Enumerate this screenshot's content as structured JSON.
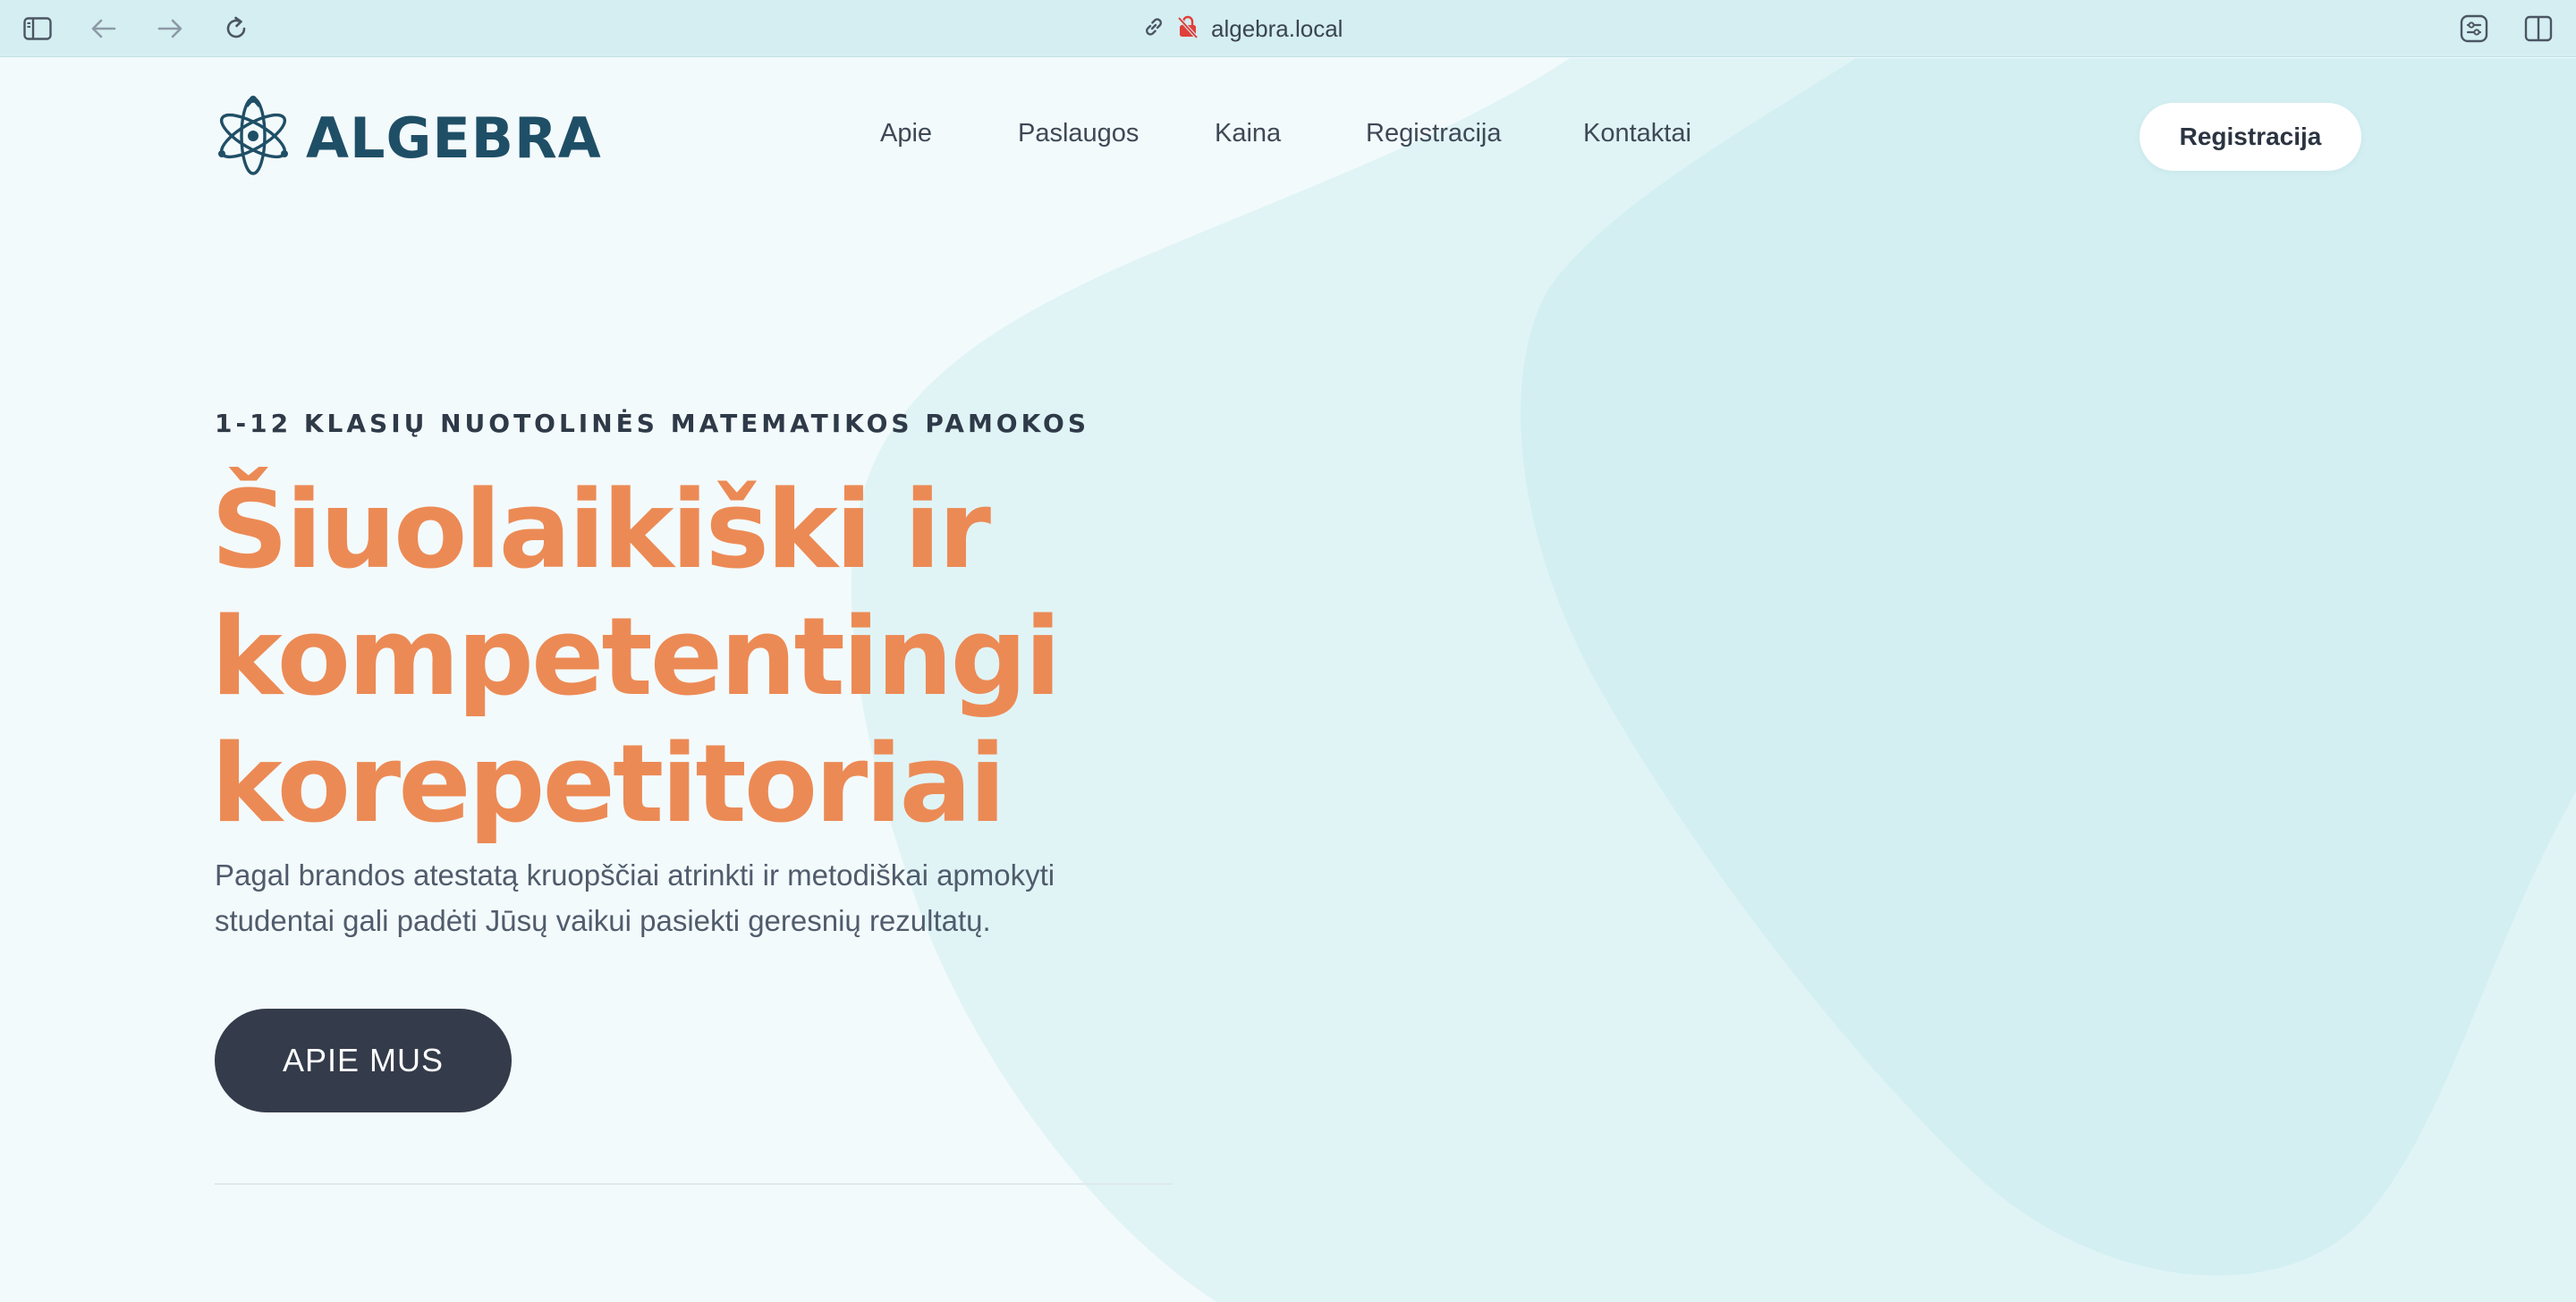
{
  "browser": {
    "url": "algebra.local",
    "icons": [
      "sidebar-toggle-icon",
      "back-arrow-icon",
      "forward-arrow-icon",
      "reload-icon",
      "link-icon",
      "insecure-lock-icon",
      "extension-icon",
      "split-view-icon"
    ]
  },
  "header": {
    "logo_text": "ALGEBRA",
    "logo_icon": "atom-icon",
    "nav": [
      "Apie",
      "Paslaugos",
      "Kaina",
      "Registracija",
      "Kontaktai"
    ],
    "cta_label": "Registracija"
  },
  "hero": {
    "eyebrow": "1-12 KLASIŲ NUOTOLINĖS MATEMATIKOS PAMOKOS",
    "headline_lines": [
      "Šiuolaikiški ir",
      "kompetentingi",
      "korepetitoriai"
    ],
    "lead": "Pagal brandos atestatą kruopščiai atrinkti ir metodiškai apmokyti studentai gali padėti Jūsų vaikui pasiekti geresnių rezultatų.",
    "button_label": "APIE MUS"
  },
  "colors": {
    "accent": "#ec8a55",
    "brand": "#1f4f66",
    "button": "#343c4b",
    "page_background": "#f3fafc",
    "blob_light": "#e0f4f6",
    "blob_dark": "#d3eff2",
    "browser_bar": "#d4eef1"
  }
}
